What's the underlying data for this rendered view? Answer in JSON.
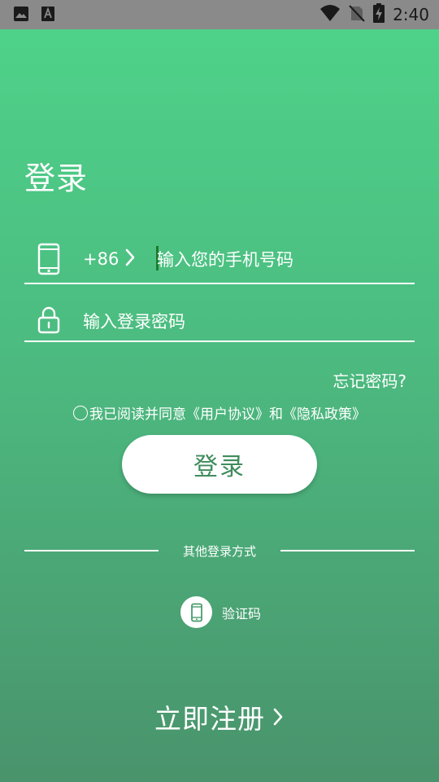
{
  "status_bar": {
    "time": "2:40",
    "left_icons": [
      "image-icon",
      "font-icon"
    ],
    "right_icons": [
      "wifi-icon",
      "no-sim-icon",
      "battery-charging-icon"
    ],
    "background": "#8a8a8a"
  },
  "login": {
    "title": "登录",
    "country_code": "+86",
    "phone_placeholder": "输入您的手机号码",
    "password_placeholder": "输入登录密码",
    "forgot_password": "忘记密码?",
    "agreement_text": "我已阅读并同意《用户协议》和《隐私政策》",
    "agreement_checked": false,
    "login_button": "登录",
    "other_methods_label": "其他登录方式",
    "alt_method_label": "验证码",
    "register_label": "立即注册"
  },
  "colors": {
    "gradient_top": "#4ed48a",
    "gradient_bottom": "#4a936c",
    "button_text": "#3f8c5c",
    "caret": "#1e7a2e"
  }
}
